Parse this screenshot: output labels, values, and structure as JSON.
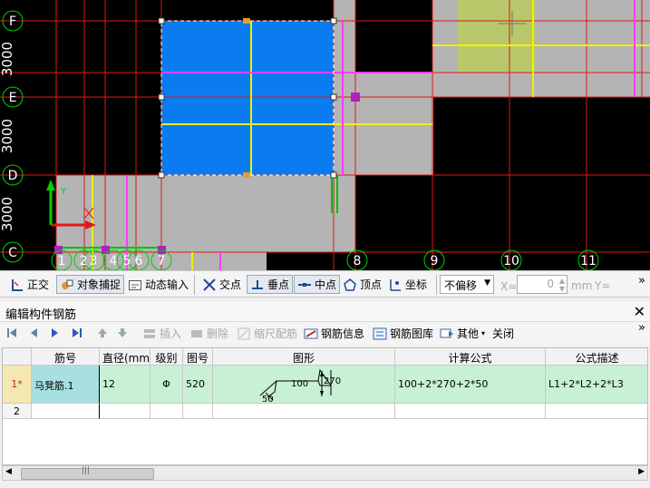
{
  "cad": {
    "axis_left": [
      {
        "label": "F"
      },
      {
        "label": "E"
      },
      {
        "label": "D"
      },
      {
        "label": "C"
      }
    ],
    "spacing_left": [
      {
        "label": "3000"
      },
      {
        "label": "3000"
      },
      {
        "label": "3000"
      }
    ],
    "axis_bottom": [
      {
        "label": "1"
      },
      {
        "label": "2"
      },
      {
        "label": "3"
      },
      {
        "label": "4"
      },
      {
        "label": "5"
      },
      {
        "label": "6"
      },
      {
        "label": "7"
      },
      {
        "label": "8"
      },
      {
        "label": "9"
      },
      {
        "label": "10"
      },
      {
        "label": "11"
      }
    ],
    "ucs_label": "Y"
  },
  "snap_toolbar": {
    "ortho": "正交",
    "object_snap": "对象捕捉",
    "dynamic_input": "动态输入",
    "intersection": "交点",
    "perpendicular": "垂点",
    "midpoint": "中点",
    "vertex": "顶点",
    "coordinate": "坐标",
    "offset_mode": "不偏移",
    "x_label": "X=",
    "x_value": "0",
    "unit": "mm",
    "y_label": "Y=",
    "more": "»"
  },
  "panel": {
    "title": "编辑构件钢筋",
    "close": "✕",
    "toolbar": {
      "insert": "插入",
      "delete": "删除",
      "scale_rebar": "缩尺配筋",
      "rebar_info": "钢筋信息",
      "rebar_library": "钢筋图库",
      "other": "其他",
      "close": "关闭",
      "more": "»"
    },
    "columns": [
      "筋号",
      "直径(mm)",
      "级别",
      "图号",
      "图形",
      "计算公式",
      "公式描述"
    ],
    "rows": [
      {
        "index": "1*",
        "name": "马凳筋.1",
        "diameter": "12",
        "grade": "Φ",
        "figure_no": "520",
        "shape_labels": {
          "a": "50",
          "b": "100",
          "c": "270"
        },
        "formula": "100+2*270+2*50",
        "formula_desc": "L1+2*L2+2*L3"
      },
      {
        "index": "2",
        "name": "",
        "diameter": "",
        "grade": "",
        "figure_no": "",
        "formula": "",
        "formula_desc": ""
      }
    ]
  },
  "colors": {
    "selected_fill": "#0a7cf0",
    "slab_gray": "#b4b4b4",
    "slab_green": "#b8c86a",
    "axis_red": "#e01818",
    "rebar_yellow": "#f0f000",
    "rebar_magenta": "#ff3cff",
    "axis_circle_green": "#00d000",
    "row_highlight": "#c8f0d4",
    "row_header_highlight": "#f5e7b0"
  }
}
